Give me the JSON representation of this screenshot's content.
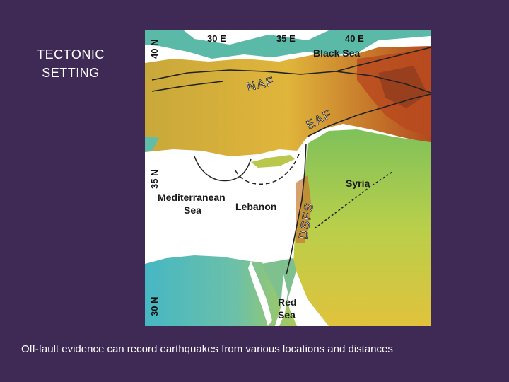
{
  "slide": {
    "title": "TECTONIC\nSETTING",
    "caption": "Off-fault evidence can record earthquakes from various locations and distances"
  },
  "map": {
    "longitude_labels": [
      "30 E",
      "35 E",
      "40 E"
    ],
    "latitude_labels": [
      "40 N",
      "35 N",
      "30 N"
    ],
    "places": {
      "black_sea": "Black Sea",
      "mediterranean_line1": "Mediterranean",
      "mediterranean_line2": "Sea",
      "lebanon": "Lebanon",
      "syria": "Syria",
      "red_sea_line1": "Red",
      "red_sea_line2": "Sea"
    },
    "faults": {
      "naf": "NAF",
      "eaf": "EAF",
      "dsfs": "DSFS"
    },
    "colors": {
      "sea": "#ffffff",
      "lowland": "#3fb9c4",
      "midland": "#e8c83a",
      "highland": "#b5481e",
      "fault_lines": "#222222"
    }
  }
}
